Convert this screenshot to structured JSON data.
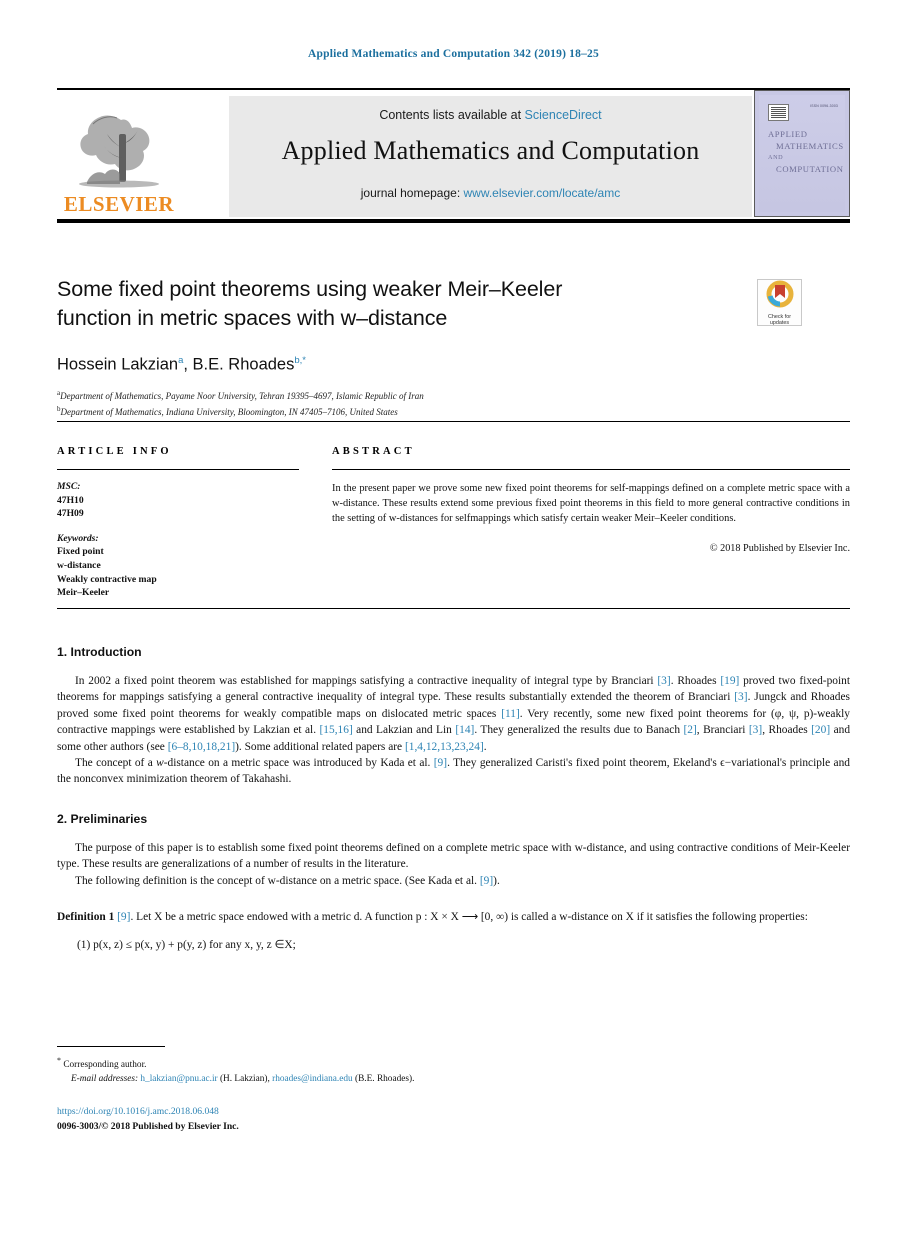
{
  "running_head": "Applied Mathematics and Computation 342 (2019) 18–25",
  "masthead": {
    "publisher_wordmark": "ELSEVIER",
    "contents_prefix": "Contents lists available at",
    "contents_link": "ScienceDirect",
    "journal_name": "Applied Mathematics and Computation",
    "homepage_prefix": "journal homepage:",
    "homepage_link": "www.elsevier.com/locate/amc",
    "cover": {
      "issn_line": "ISSN 0096-3003",
      "line1": "APPLIED",
      "line2": "MATHEMATICS",
      "line3": "AND",
      "line4": "COMPUTATION"
    }
  },
  "article": {
    "title_line1": "Some fixed point theorems using weaker Meir–Keeler",
    "title_line2": "function in metric spaces with w–distance",
    "authors": [
      {
        "name": "Hossein Lakzian",
        "marks": "a"
      },
      {
        "name": "B.E. Rhoades",
        "marks": "b,*"
      }
    ],
    "affiliations": [
      {
        "mark": "a",
        "text": "Department of Mathematics, Payame Noor University, Tehran 19395–4697, Islamic Republic of Iran"
      },
      {
        "mark": "b",
        "text": "Department of Mathematics, Indiana University, Bloomington, IN 47405–7106, United States"
      }
    ],
    "crossmark": {
      "line1": "Check for",
      "line2": "updates"
    }
  },
  "article_info": {
    "heading": "ARTICLE INFO",
    "msc_label": "MSC:",
    "msc_values": [
      "47H10",
      "47H09"
    ],
    "keywords_label": "Keywords:",
    "keywords": [
      "Fixed point",
      "w-distance",
      "Weakly contractive map",
      "Meir–Keeler"
    ]
  },
  "abstract": {
    "heading": "ABSTRACT",
    "text": "In the present paper we prove some new fixed point theorems for self-mappings defined on a complete metric space with a w-distance. These results extend some previous fixed point theorems in this field to more general contractive conditions in the setting of w-distances for selfmappings which satisfy certain weaker Meir–Keeler conditions.",
    "copyright": "© 2018 Published by Elsevier Inc."
  },
  "sections": {
    "intro_heading": "1. Introduction",
    "intro_p1_a": "In 2002 a fixed point theorem was established for mappings satisfying a contractive inequality of integral type by Branciari ",
    "intro_p1_r1": "[3]",
    "intro_p1_b": ". Rhoades ",
    "intro_p1_r2": "[19]",
    "intro_p1_c": " proved two fixed-point theorems for mappings satisfying a general contractive inequality of integral type. These results substantially extended the theorem of Branciari ",
    "intro_p1_r3": "[3]",
    "intro_p1_d": ". Jungck and Rhoades proved some fixed point theorems for weakly compatible maps on dislocated metric spaces ",
    "intro_p1_r4": "[11]",
    "intro_p1_e": ". Very recently, some new fixed point theorems for (φ, ψ, p)-weakly contractive mappings were established by Lakzian et al. ",
    "intro_p1_r5": "[15,16]",
    "intro_p1_f": " and Lakzian and Lin ",
    "intro_p1_r6": "[14]",
    "intro_p1_g": ". They generalized the results due to Banach ",
    "intro_p1_r7": "[2]",
    "intro_p1_h": ", Branciari ",
    "intro_p1_r8": "[3]",
    "intro_p1_i": ", Rhoades ",
    "intro_p1_r9": "[20]",
    "intro_p1_j": " and some other authors (see ",
    "intro_p1_r10": "[6–8,10,18,21]",
    "intro_p1_k": "). Some additional related papers are ",
    "intro_p1_r11": "[1,4,12,13,23,24]",
    "intro_p1_l": ".",
    "intro_p2_a": "The concept of a ",
    "intro_p2_it1": "w",
    "intro_p2_b": "-distance on a metric space was introduced by Kada et al. ",
    "intro_p2_r1": "[9]",
    "intro_p2_c": ". They generalized Caristi's fixed point theorem, Ekeland's ϵ−variational's principle and the nonconvex minimization theorem of Takahashi.",
    "prelim_heading": "2. Preliminaries",
    "prelim_p1": "The purpose of this paper is to establish some fixed point theorems defined on a complete metric space with w-distance, and using contractive conditions of Meir-Keeler type. These results are generalizations of a number of results in the literature.",
    "prelim_p2_a": "The following definition is the concept of w-distance on a metric space. (See Kada et al. ",
    "prelim_p2_r1": "[9]",
    "prelim_p2_b": ").",
    "definition_label": "Definition 1",
    "definition_ref": "[9]",
    "definition_a": ". Let X be a metric space endowed with a metric d. A function p : X × X ⟶ [0, ∞) is called a w-distance on X if it satisfies the following properties:",
    "definition_item1": "(1)  p(x, z) ≤ p(x, y) + p(y, z) for any x, y, z ∈X;"
  },
  "footer": {
    "corresponding_star": "*",
    "corresponding_text": "Corresponding author.",
    "email_label": "E-mail addresses:",
    "email1": "h_lakzian@pnu.ac.ir",
    "email1_owner": " (H. Lakzian), ",
    "email2": "rhoades@indiana.edu",
    "email2_owner": " (B.E. Rhoades).",
    "doi": "https://doi.org/10.1016/j.amc.2018.06.048",
    "issn_line": "0096-3003/© 2018 Published by Elsevier Inc."
  },
  "colors": {
    "link": "#2e84b4",
    "elsevier_orange": "#ec8b22",
    "banner_bg": "#e9e9e9",
    "cover_bg": "#c8c8e4"
  }
}
